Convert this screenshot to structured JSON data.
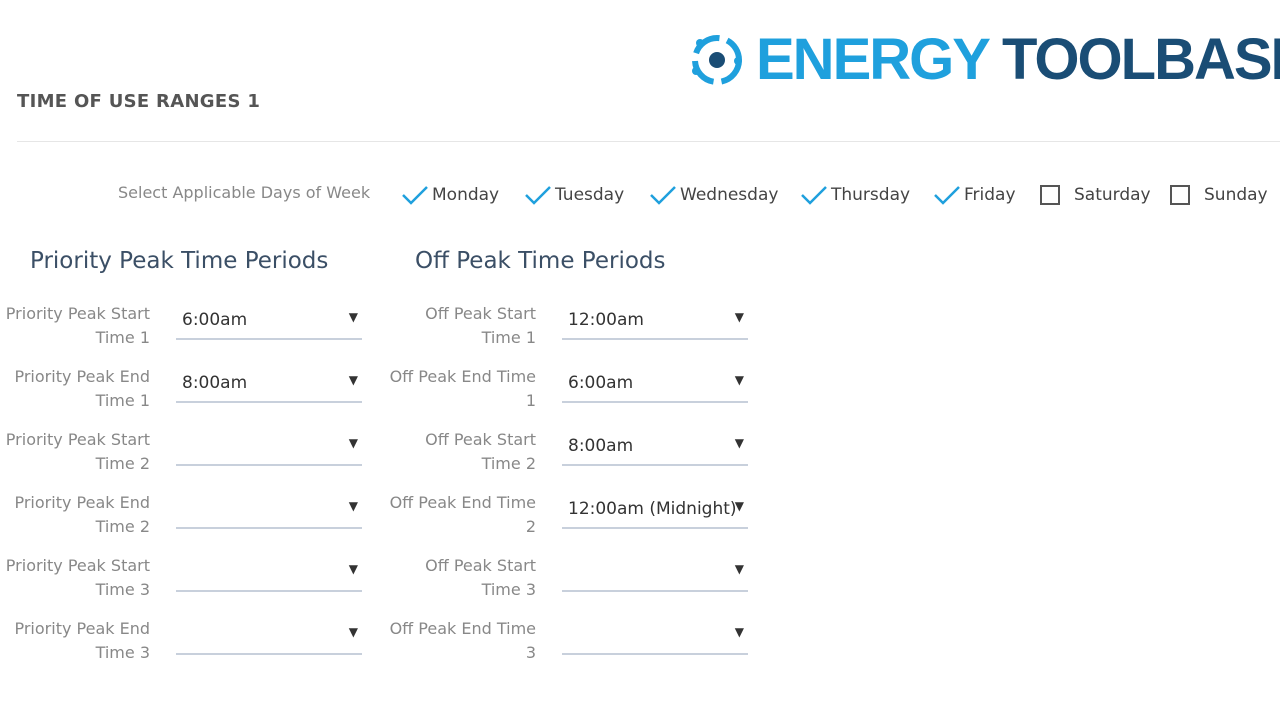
{
  "logo": {
    "part1": "ENERGY",
    "part2": "TOOLBASE",
    "tm": "™",
    "icon": "energy-toolbase-logo-icon",
    "colors": {
      "light": "#1fa0dd",
      "dark": "#1a4d75"
    }
  },
  "section_title": "TIME OF USE RANGES 1",
  "days": {
    "label": "Select Applicable Days of Week",
    "items": [
      {
        "label": "Monday",
        "checked": true
      },
      {
        "label": "Tuesday",
        "checked": true
      },
      {
        "label": "Wednesday",
        "checked": true
      },
      {
        "label": "Thursday",
        "checked": true
      },
      {
        "label": "Friday",
        "checked": true
      },
      {
        "label": "Saturday",
        "checked": false
      },
      {
        "label": "Sunday",
        "checked": false
      }
    ],
    "check_color": "#1fa0dd"
  },
  "priority": {
    "title": "Priority Peak Time Periods",
    "rows": [
      {
        "label": "Priority Peak Start Time 1",
        "value": "6:00am"
      },
      {
        "label": "Priority Peak End Time 1",
        "value": "8:00am"
      },
      {
        "label": "Priority Peak Start Time 2",
        "value": ""
      },
      {
        "label": "Priority Peak End Time 2",
        "value": ""
      },
      {
        "label": "Priority Peak Start Time 3",
        "value": ""
      },
      {
        "label": "Priority Peak End Time 3",
        "value": ""
      }
    ]
  },
  "offpeak": {
    "title": "Off Peak Time Periods",
    "rows": [
      {
        "label": "Off Peak Start Time 1",
        "value": "12:00am"
      },
      {
        "label": "Off Peak End Time 1",
        "value": "6:00am"
      },
      {
        "label": "Off Peak Start Time 2",
        "value": "8:00am"
      },
      {
        "label": "Off Peak End Time 2",
        "value": "12:00am (Midnight)"
      },
      {
        "label": "Off Peak Start Time 3",
        "value": ""
      },
      {
        "label": "Off Peak End Time 3",
        "value": ""
      }
    ]
  },
  "dropdown_arrow": "▼"
}
